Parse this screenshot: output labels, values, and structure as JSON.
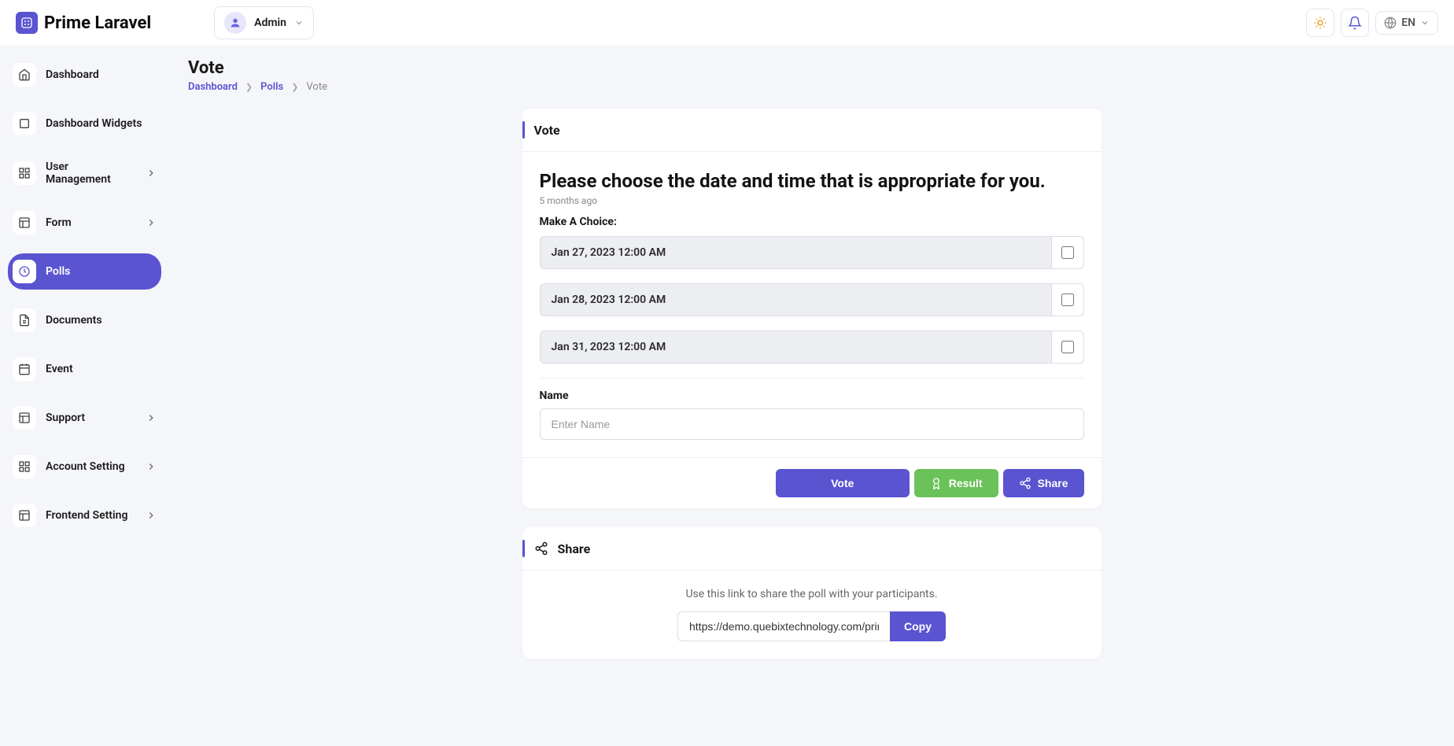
{
  "brand": "Prime Laravel",
  "user": {
    "name": "Admin"
  },
  "lang": "EN",
  "sidebar": {
    "items": [
      {
        "label": "Dashboard",
        "chev": false
      },
      {
        "label": "Dashboard Widgets",
        "chev": false
      },
      {
        "label": "User Management",
        "chev": true
      },
      {
        "label": "Form",
        "chev": true
      },
      {
        "label": "Polls",
        "chev": false,
        "active": true
      },
      {
        "label": "Documents",
        "chev": false
      },
      {
        "label": "Event",
        "chev": false
      },
      {
        "label": "Support",
        "chev": true
      },
      {
        "label": "Account Setting",
        "chev": true
      },
      {
        "label": "Frontend Setting",
        "chev": true
      }
    ]
  },
  "page": {
    "title": "Vote",
    "breadcrumb": {
      "a": "Dashboard",
      "b": "Polls",
      "c": "Vote"
    }
  },
  "vote_card": {
    "title": "Vote",
    "question": "Please choose the date and time that is appropriate for you.",
    "age": "5 months ago",
    "make_choice": "Make A Choice:",
    "choices": [
      "Jan 27, 2023 12:00 AM",
      "Jan 28, 2023 12:00 AM",
      "Jan 31, 2023 12:00 AM"
    ],
    "name_label": "Name",
    "name_placeholder": "Enter Name",
    "vote_btn": "Vote",
    "result_btn": "Result",
    "share_btn": "Share"
  },
  "share_card": {
    "title": "Share",
    "hint": "Use this link to share the poll with your participants.",
    "url": "https://demo.quebixtechnology.com/prime/pol",
    "copy": "Copy"
  }
}
